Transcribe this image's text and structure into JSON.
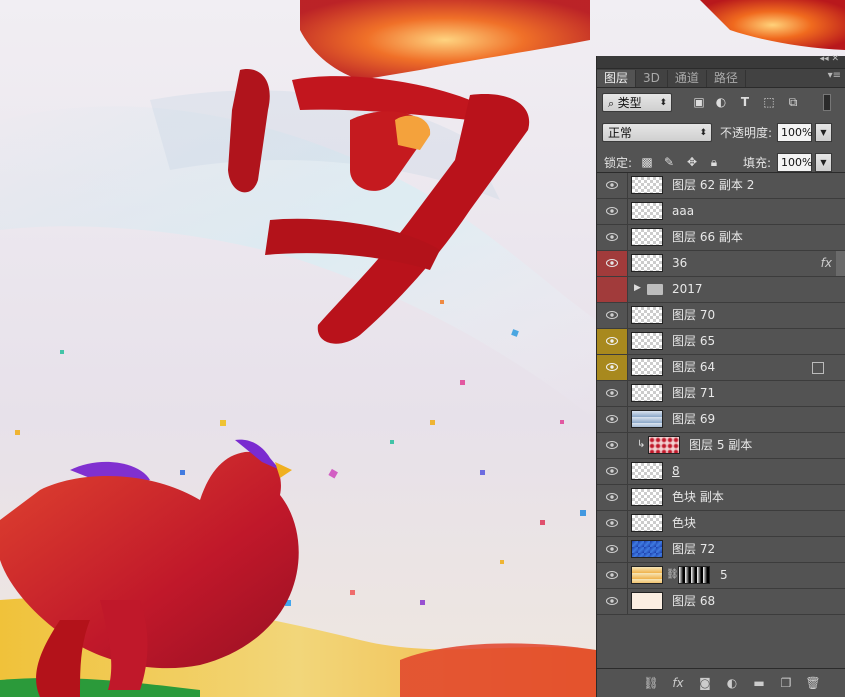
{
  "panel": {
    "tabs": [
      "图层",
      "3D",
      "通道",
      "路径"
    ],
    "filter": {
      "label": "类型"
    },
    "blend": {
      "mode": "正常",
      "opacity_label": "不透明度:",
      "opacity": "100%"
    },
    "lock": {
      "label": "锁定:",
      "fill_label": "填充:",
      "fill": "100%"
    },
    "layers": [
      {
        "name": "图层 62 副本 2"
      },
      {
        "name": "aaa"
      },
      {
        "name": "图层 66 副本"
      },
      {
        "name": "36",
        "fx": "fx"
      },
      {
        "name": "2017"
      },
      {
        "name": "图层 70"
      },
      {
        "name": "图层 65"
      },
      {
        "name": "图层 64"
      },
      {
        "name": "图层 71"
      },
      {
        "name": "图层 69"
      },
      {
        "name": "图层 5 副本"
      },
      {
        "name": "8"
      },
      {
        "name": "色块 副本"
      },
      {
        "name": "色块"
      },
      {
        "name": "图层 72"
      },
      {
        "name": "5"
      },
      {
        "name": "图层 68"
      }
    ],
    "colors": {
      "eye_red": "#a13b3b",
      "eye_yellow": "#a8891e",
      "panel_bg": "#535353"
    }
  }
}
